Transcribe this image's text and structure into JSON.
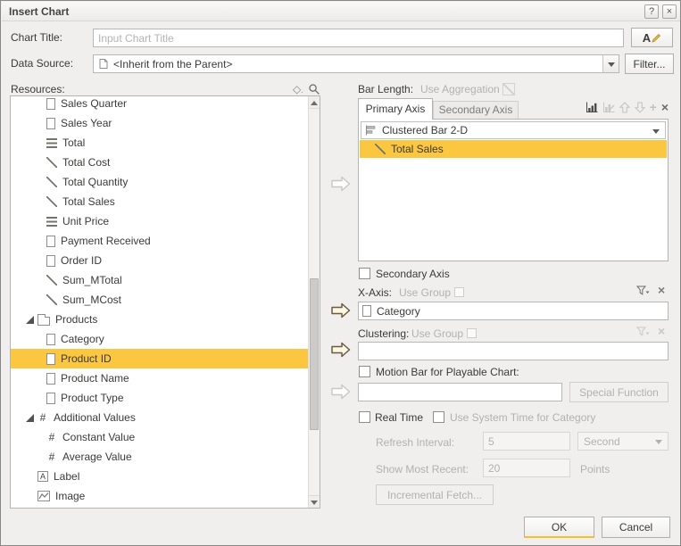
{
  "colors": {
    "highlight": "#FBC640",
    "accent": "#F2C12E",
    "disabled_text": "#B3B1AE"
  },
  "titlebar": {
    "title": "Insert Chart",
    "help_label": "?",
    "close_label": "×"
  },
  "header": {
    "chart_title_label": "Chart Title:",
    "chart_title_placeholder": "Input Chart Title",
    "data_source_label": "Data Source:",
    "data_source_value": "<Inherit from the Parent>",
    "filter_button": "Filter..."
  },
  "resources": {
    "label": "Resources:",
    "items": [
      {
        "label": "Sales Quarter",
        "icon": "field"
      },
      {
        "label": "Sales Year",
        "icon": "field"
      },
      {
        "label": "Total",
        "icon": "lines"
      },
      {
        "label": "Total Cost",
        "icon": "diagonal"
      },
      {
        "label": "Total Quantity",
        "icon": "diagonal"
      },
      {
        "label": "Total Sales",
        "icon": "diagonal"
      },
      {
        "label": "Unit Price",
        "icon": "lines"
      },
      {
        "label": "Payment Received",
        "icon": "field"
      },
      {
        "label": "Order ID",
        "icon": "field"
      },
      {
        "label": "Sum_MTotal",
        "icon": "diagonal"
      },
      {
        "label": "Sum_MCost",
        "icon": "diagonal"
      },
      {
        "label": "Products",
        "icon": "folder",
        "expanded": true
      },
      {
        "label": "Category",
        "icon": "field"
      },
      {
        "label": "Product ID",
        "icon": "field",
        "selected": true
      },
      {
        "label": "Product Name",
        "icon": "field"
      },
      {
        "label": "Product Type",
        "icon": "field"
      },
      {
        "label": "Additional Values",
        "icon": "hash",
        "expanded": true
      },
      {
        "label": "Constant Value",
        "icon": "hash"
      },
      {
        "label": "Average Value",
        "icon": "hash"
      },
      {
        "label": "Label",
        "icon": "A"
      },
      {
        "label": "Image",
        "icon": "image"
      }
    ]
  },
  "bar_length": {
    "label": "Bar Length:",
    "hint": "Use Aggregation"
  },
  "axis_tabs": {
    "primary": "Primary Axis",
    "secondary": "Secondary Axis"
  },
  "series_panel": {
    "chart_type": "Clustered Bar 2-D",
    "items": [
      {
        "label": "Total Sales",
        "selected": true
      }
    ]
  },
  "secondary_axis": {
    "label": "Secondary Axis",
    "checked": false
  },
  "x_axis": {
    "label": "X-Axis:",
    "hint": "Use Group",
    "value": "Category"
  },
  "clustering": {
    "label": "Clustering:",
    "hint": "Use Group",
    "value": ""
  },
  "motion": {
    "label": "Motion Bar for Playable Chart:",
    "checked": false,
    "value": "",
    "special_button": "Special Function"
  },
  "real_time": {
    "real_time_label": "Real Time",
    "real_time_checked": false,
    "system_time_label": "Use System Time for Category",
    "system_time_checked": false,
    "refresh_label": "Refresh Interval:",
    "refresh_value": "5",
    "refresh_unit": "Second",
    "recent_label": "Show Most Recent:",
    "recent_value": "20",
    "points_label": "Points",
    "incremental_button": "Incremental Fetch..."
  },
  "footer": {
    "ok": "OK",
    "cancel": "Cancel"
  },
  "icon_names": [
    "help-icon",
    "close-icon",
    "font-format-icon",
    "data-source-sheet-icon",
    "dropdown-arrow-icon",
    "sort-icon",
    "search-icon",
    "expand-caret-icon",
    "folder-icon",
    "field-icon",
    "summary-diagonal-icon",
    "lines-icon",
    "hash-icon",
    "label-a-icon",
    "image-icon",
    "bar-chart-icon",
    "chart-edit-icon",
    "move-up-icon",
    "move-down-icon",
    "add-icon",
    "remove-icon",
    "filter-funnel-icon",
    "clear-icon",
    "block-arrow-icon",
    "checkbox"
  ]
}
